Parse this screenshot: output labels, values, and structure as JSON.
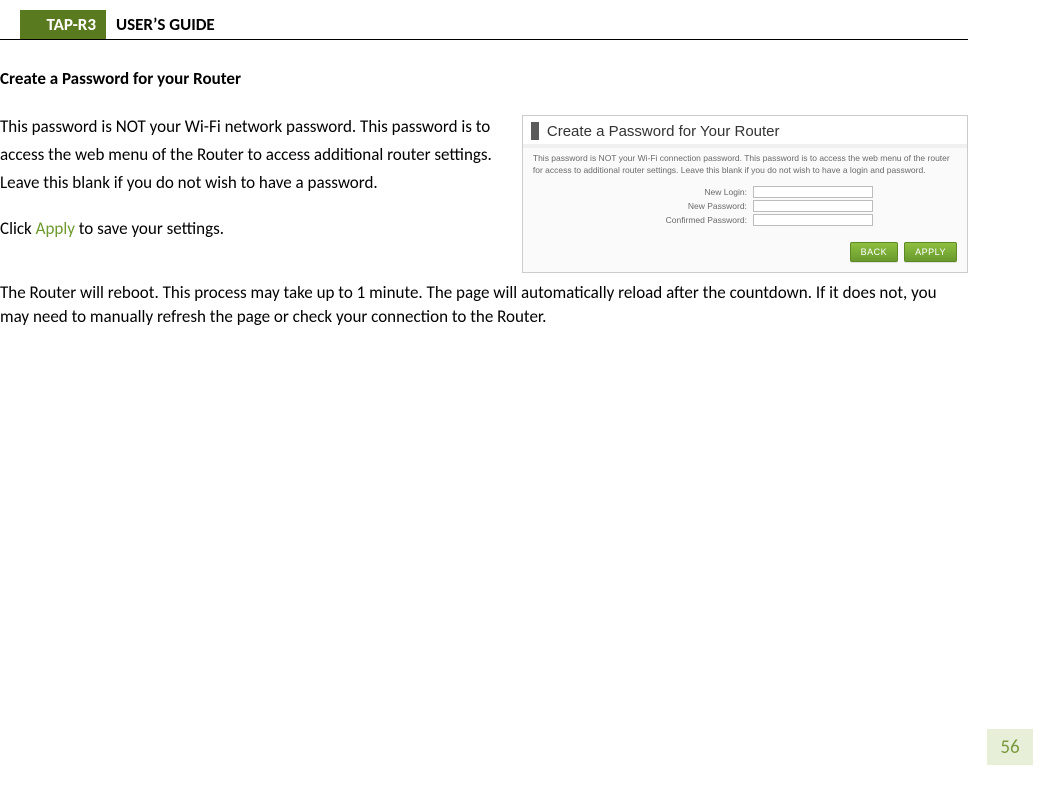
{
  "header": {
    "product": "TAP-R3",
    "title": "USER’S GUIDE"
  },
  "section": {
    "heading": "Create a Password for your Router",
    "paragraph1": "This password is NOT your Wi-Fi network password. This password is to access the web menu of the Router to access additional router settings. Leave this blank if you do not wish to have a password.",
    "apply_sentence_prefix": "Click ",
    "apply_word": "Apply",
    "apply_sentence_suffix": " to save your settings.",
    "paragraph3": "The Router will reboot. This process may take up to 1 minute. The page will automatically reload after the countdown. If it does not, you may need to manually refresh the page or check your connection to the Router."
  },
  "screenshot": {
    "title": "Create a Password for Your Router",
    "desc": "This password is NOT your Wi-Fi connection password. This password is to access the web menu of the router for access to additional router settings. Leave this blank if you do not wish to have a login and password.",
    "fields": {
      "login_label": "New Login:",
      "password_label": "New Password:",
      "confirm_label": "Confirmed Password:"
    },
    "buttons": {
      "back": "BACK",
      "apply": "APPLY"
    }
  },
  "page_number": "56",
  "colors": {
    "accent": "#5a7a1f",
    "apply_text": "#6e9a2f",
    "page_num_bg": "#e8efd9",
    "page_num_fg": "#7a9a3f"
  }
}
